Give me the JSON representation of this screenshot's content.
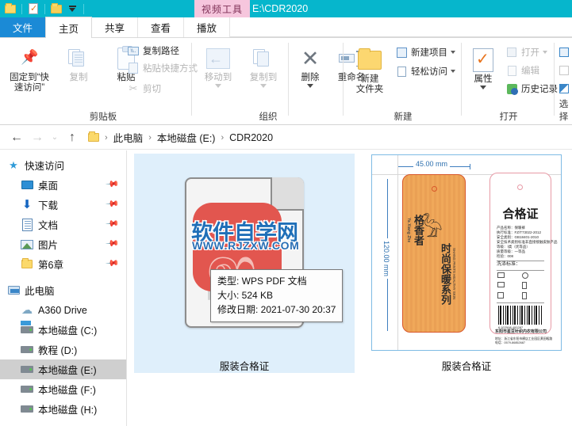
{
  "titlebar": {
    "context_tool_label": "视频工具",
    "window_title": "E:\\CDR2020",
    "quick_access": [
      {
        "name": "properties-folder-icon",
        "label": "属性"
      },
      {
        "name": "new-folder-checklist-icon",
        "label": "新建文件夹"
      },
      {
        "name": "folder-icon",
        "label": "文件夹"
      },
      {
        "name": "customize-qat-icon",
        "label": "自定义快速访问工具栏"
      }
    ]
  },
  "tabs": [
    {
      "label": "文件",
      "active": false,
      "kind": "file"
    },
    {
      "label": "主页",
      "active": true,
      "kind": "normal"
    },
    {
      "label": "共享",
      "active": false,
      "kind": "normal"
    },
    {
      "label": "查看",
      "active": false,
      "kind": "normal"
    },
    {
      "label": "播放",
      "active": false,
      "kind": "normal"
    }
  ],
  "ribbon": {
    "groups": [
      {
        "title": "剪贴板",
        "big_buttons": [
          {
            "label": "固定到“快\n速访问”",
            "icon": "pin-icon",
            "disabled": false
          },
          {
            "label": "复制",
            "icon": "copy-icon",
            "disabled": true
          },
          {
            "label": "粘贴",
            "icon": "paste-icon",
            "disabled": false
          }
        ],
        "small_buttons": [
          {
            "label": "复制路径",
            "icon": "copy-path-icon",
            "disabled": false
          },
          {
            "label": "粘贴快捷方式",
            "icon": "paste-shortcut-icon",
            "disabled": true
          },
          {
            "label": "剪切",
            "icon": "scissors-icon",
            "disabled": true
          }
        ]
      },
      {
        "title": "组织",
        "big_buttons": [
          {
            "label": "移动到",
            "icon": "move-to-icon",
            "disabled": true,
            "has_caret": true
          },
          {
            "label": "复制到",
            "icon": "copy-to-icon",
            "disabled": true,
            "has_caret": true
          },
          {
            "label": "删除",
            "icon": "delete-x-icon",
            "disabled": false,
            "has_caret": true
          },
          {
            "label": "重命名",
            "icon": "rename-icon",
            "disabled": false
          }
        ]
      },
      {
        "title": "新建",
        "big_buttons": [
          {
            "label": "新建\n文件夹",
            "icon": "new-folder-icon",
            "disabled": false
          }
        ],
        "small_buttons": [
          {
            "label": "新建项目",
            "icon": "new-item-icon",
            "disabled": false,
            "has_caret": true
          },
          {
            "label": "轻松访问",
            "icon": "easy-access-icon",
            "disabled": false,
            "has_caret": true
          }
        ]
      },
      {
        "title": "打开",
        "big_buttons": [
          {
            "label": "属性",
            "icon": "properties-icon",
            "disabled": false,
            "has_caret": true
          }
        ],
        "small_buttons": [
          {
            "label": "打开",
            "icon": "open-icon",
            "disabled": true,
            "has_caret": true
          },
          {
            "label": "编辑",
            "icon": "edit-icon",
            "disabled": true
          },
          {
            "label": "历史记录",
            "icon": "history-icon",
            "disabled": false
          }
        ]
      },
      {
        "title": "选择",
        "small_buttons": [
          {
            "label": "全部选择",
            "icon": "select-all-icon",
            "disabled": false
          },
          {
            "label": "全部取消",
            "icon": "select-none-icon",
            "disabled": true
          },
          {
            "label": "反向选择",
            "icon": "invert-selection-icon",
            "disabled": false
          }
        ]
      }
    ]
  },
  "addressbar": {
    "back_icon": "back-arrow-icon",
    "forward_icon": "forward-arrow-icon",
    "recent_icon": "recent-locations-icon",
    "up_icon": "up-arrow-icon",
    "folder_icon": "address-folder-icon",
    "breadcrumbs": [
      "此电脑",
      "本地磁盘 (E:)",
      "CDR2020"
    ]
  },
  "sidebar": {
    "items": [
      {
        "label": "快速访问",
        "icon": "quick-access-star-icon",
        "level": 0,
        "pinned": false,
        "selected": false
      },
      {
        "label": "桌面",
        "icon": "desktop-icon",
        "level": 1,
        "pinned": true,
        "selected": false
      },
      {
        "label": "下载",
        "icon": "downloads-icon",
        "level": 1,
        "pinned": true,
        "selected": false
      },
      {
        "label": "文档",
        "icon": "documents-icon",
        "level": 1,
        "pinned": true,
        "selected": false
      },
      {
        "label": "图片",
        "icon": "pictures-icon",
        "level": 1,
        "pinned": true,
        "selected": false
      },
      {
        "label": "第6章",
        "icon": "folder-icon",
        "level": 1,
        "pinned": true,
        "selected": false
      },
      {
        "label": "此电脑",
        "icon": "this-pc-icon",
        "level": 0,
        "pinned": false,
        "selected": false
      },
      {
        "label": "A360 Drive",
        "icon": "a360-drive-icon",
        "level": 1,
        "pinned": false,
        "selected": false
      },
      {
        "label": "本地磁盘 (C:)",
        "icon": "system-drive-icon",
        "level": 1,
        "pinned": false,
        "selected": false
      },
      {
        "label": "教程 (D:)",
        "icon": "drive-icon",
        "level": 1,
        "pinned": false,
        "selected": false
      },
      {
        "label": "本地磁盘 (E:)",
        "icon": "drive-icon",
        "level": 1,
        "pinned": false,
        "selected": true
      },
      {
        "label": "本地磁盘 (F:)",
        "icon": "drive-icon",
        "level": 1,
        "pinned": false,
        "selected": false
      },
      {
        "label": "本地磁盘 (H:)",
        "icon": "drive-icon",
        "level": 1,
        "pinned": false,
        "selected": false
      }
    ]
  },
  "content": {
    "items": [
      {
        "name": "服装合格证",
        "kind": "pdf",
        "selected": true,
        "pdf_label": "PDF",
        "watermark": {
          "text": "软件自学网",
          "url": "WWW.RJZXW.COM"
        }
      },
      {
        "name": "服装合格证",
        "kind": "artwork",
        "selected": false,
        "artwork": {
          "width_label": "45.00 mm",
          "height_label": "120.00 mm",
          "cert_title": "合格证",
          "brand_cn": "格香者",
          "brand_en": "Ya Xiang Zhe",
          "series_cn": "时尚保暖系列",
          "series_en": "SHANG PANTS HEALTHY SKIN",
          "info_lines": [
            "产品名称：保暖裤",
            "执行标准：FZ/T73022-2012",
            "安全类别：GB18401-2010",
            "安全技术类别标准非直接接触皮肤产品",
            "等级：Ⅰ类（优等品）",
            "质量等级：一等品",
            "检验：008"
          ],
          "wash_title": "洗涤标准：",
          "barcode_number": "6 922598 400287",
          "company": "东阳市星豆针织内衣有限公司",
          "address": "地址：浙江省东阳市横店工业园区黄田畈路",
          "phone": "电话：0579-86852687"
        }
      }
    ]
  },
  "tooltip": {
    "lines": [
      "类型: WPS PDF 文档",
      "大小: 524 KB",
      "修改日期: 2021-07-30 20:37"
    ]
  },
  "colors": {
    "titlebar": "#06b6cc",
    "context_tool_bg": "#f6c6dd",
    "file_tab": "#1b8ad6",
    "selection": "#dfeffb",
    "sidebar_selection": "#cfcfcf",
    "watermark_red": "#e2564f",
    "watermark_blue": "#1f6fb8"
  }
}
